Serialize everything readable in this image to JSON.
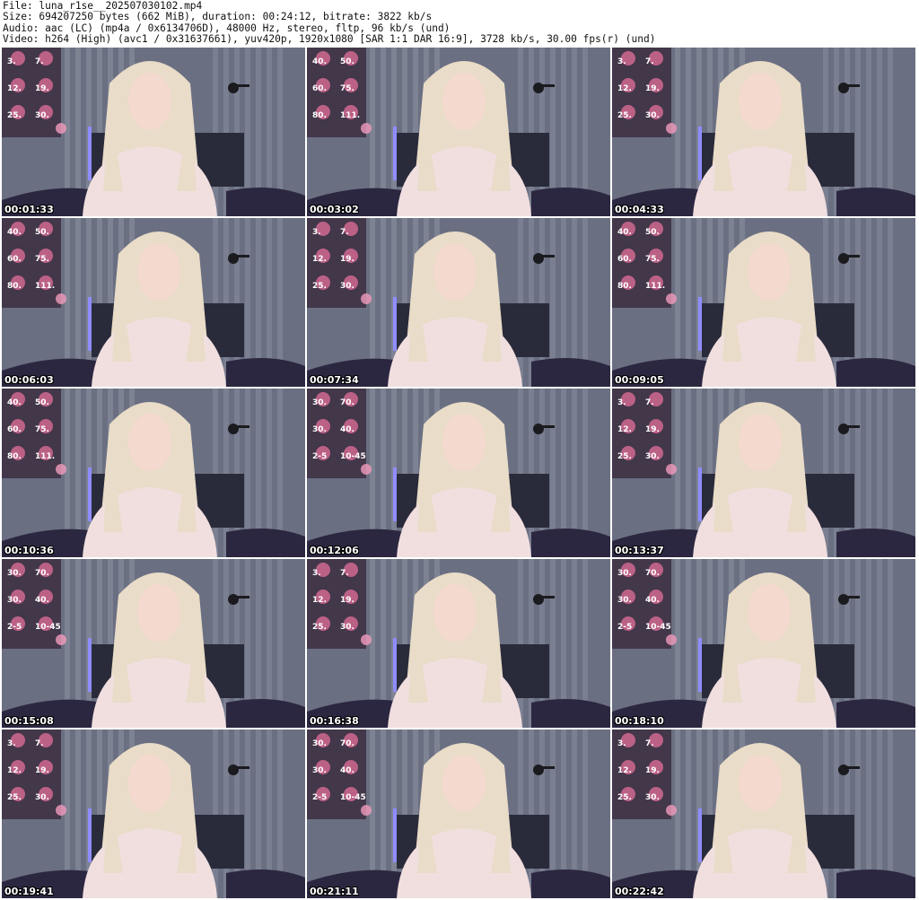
{
  "header": {
    "file_line": "File: luna_r1se__202507030102.mp4",
    "size_line": "Size: 694207250 bytes (662 MiB), duration: 00:24:12, bitrate: 3822 kb/s",
    "audio_line": "Audio: aac (LC) (mp4a / 0x6134706D), 48000 Hz, stereo, fltp, 96 kb/s (und)",
    "video_line": "Video: h264 (High) (avc1 / 0x31637661), yuv420p, 1920x1080 [SAR 1:1 DAR 16:9], 3728 kb/s, 30.00 fps(r) (und)"
  },
  "thumbnails": [
    {
      "timestamp": "00:01:33",
      "overlay": [
        "3.",
        "7.",
        "12.",
        "19.",
        "25.",
        "30."
      ]
    },
    {
      "timestamp": "00:03:02",
      "overlay": [
        "40.",
        "50.",
        "60.",
        "75.",
        "80.",
        "111."
      ]
    },
    {
      "timestamp": "00:04:33",
      "overlay": [
        "3.",
        "7.",
        "12.",
        "19.",
        "25.",
        "30."
      ]
    },
    {
      "timestamp": "00:06:03",
      "overlay": [
        "40.",
        "50.",
        "60.",
        "75.",
        "80.",
        "111."
      ]
    },
    {
      "timestamp": "00:07:34",
      "overlay": [
        "3.",
        "7.",
        "12.",
        "19.",
        "25.",
        "30."
      ]
    },
    {
      "timestamp": "00:09:05",
      "overlay": [
        "40.",
        "50.",
        "60.",
        "75.",
        "80.",
        "111."
      ]
    },
    {
      "timestamp": "00:10:36",
      "overlay": [
        "40.",
        "50.",
        "60.",
        "75.",
        "80.",
        "111."
      ]
    },
    {
      "timestamp": "00:12:06",
      "overlay": [
        "30.",
        "70.",
        "30.",
        "40.",
        "2-5",
        "10-45"
      ]
    },
    {
      "timestamp": "00:13:37",
      "overlay": [
        "3.",
        "7.",
        "12.",
        "19.",
        "25.",
        "30."
      ]
    },
    {
      "timestamp": "00:15:08",
      "overlay": [
        "30.",
        "70.",
        "30.",
        "40.",
        "2-5",
        "10-45"
      ]
    },
    {
      "timestamp": "00:16:38",
      "overlay": [
        "3.",
        "7.",
        "12.",
        "19.",
        "25.",
        "30."
      ]
    },
    {
      "timestamp": "00:18:10",
      "overlay": [
        "30.",
        "70.",
        "30.",
        "40.",
        "2-5",
        "10-45"
      ]
    },
    {
      "timestamp": "00:19:41",
      "overlay": [
        "3.",
        "7.",
        "12.",
        "19.",
        "25.",
        "30."
      ]
    },
    {
      "timestamp": "00:21:11",
      "overlay": [
        "30.",
        "70.",
        "30.",
        "40.",
        "2-5",
        "10-45"
      ]
    },
    {
      "timestamp": "00:22:42",
      "overlay": [
        "3.",
        "7.",
        "12.",
        "19.",
        "25.",
        "30."
      ]
    }
  ],
  "colors": {
    "background": "#ffffff",
    "header_text": "#111111",
    "timestamp_text": "#ffffff",
    "wall": "#6a6f82",
    "curtain": "#8e93a3",
    "led_strip": "#8f8cff",
    "hair": "#e9dcc8",
    "blouse": "#f1dfe0",
    "overlay_panel": "#3b2b3e",
    "overlay_heart": "#f0739f"
  }
}
